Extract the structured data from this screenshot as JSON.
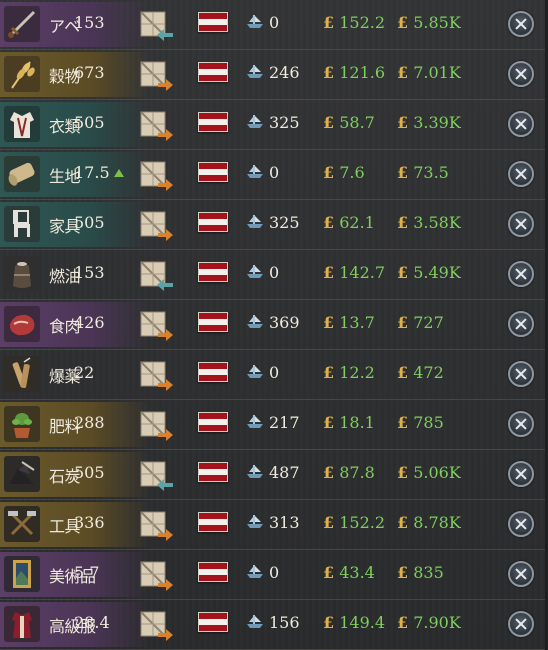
{
  "rows": [
    {
      "icon": "sword-icon",
      "name": "アベ",
      "amount": "153",
      "trend": false,
      "crate_arrow": "in",
      "ships": "0",
      "price": "152.2",
      "total": "5.85K",
      "bg": "purple"
    },
    {
      "icon": "wheat-icon",
      "name": "穀物",
      "amount": "673",
      "trend": false,
      "crate_arrow": "out",
      "ships": "246",
      "price": "121.6",
      "total": "7.01K",
      "bg": "gold"
    },
    {
      "icon": "clothes-icon",
      "name": "衣類",
      "amount": "505",
      "trend": false,
      "crate_arrow": "out",
      "ships": "325",
      "price": "58.7",
      "total": "3.39K",
      "bg": "teal"
    },
    {
      "icon": "fabric-roll-icon",
      "name": "生地",
      "amount": "17.5",
      "trend": true,
      "crate_arrow": "out",
      "ships": "0",
      "price": "7.6",
      "total": "73.5",
      "bg": "teal"
    },
    {
      "icon": "chair-icon",
      "name": "家具",
      "amount": "505",
      "trend": false,
      "crate_arrow": "out",
      "ships": "325",
      "price": "62.1",
      "total": "3.58K",
      "bg": "teal"
    },
    {
      "icon": "oil-barrel-icon",
      "name": "燃油",
      "amount": "153",
      "trend": false,
      "crate_arrow": "in",
      "ships": "0",
      "price": "142.7",
      "total": "5.49K",
      "bg": "none"
    },
    {
      "icon": "meat-icon",
      "name": "食肉",
      "amount": "426",
      "trend": false,
      "crate_arrow": "out",
      "ships": "369",
      "price": "13.7",
      "total": "727",
      "bg": "purple"
    },
    {
      "icon": "explosives-icon",
      "name": "爆薬",
      "amount": "22",
      "trend": false,
      "crate_arrow": "out",
      "ships": "0",
      "price": "12.2",
      "total": "472",
      "bg": "none"
    },
    {
      "icon": "fertilizer-plant-icon",
      "name": "肥料",
      "amount": "288",
      "trend": false,
      "crate_arrow": "out",
      "ships": "217",
      "price": "18.1",
      "total": "785",
      "bg": "gold"
    },
    {
      "icon": "coal-icon",
      "name": "石炭",
      "amount": "505",
      "trend": false,
      "crate_arrow": "in",
      "ships": "487",
      "price": "87.8",
      "total": "5.06K",
      "bg": "gold"
    },
    {
      "icon": "tools-icon",
      "name": "工具",
      "amount": "336",
      "trend": false,
      "crate_arrow": "out",
      "ships": "313",
      "price": "152.2",
      "total": "8.78K",
      "bg": "gold"
    },
    {
      "icon": "painting-icon",
      "name": "美術品",
      "amount": "5.7",
      "trend": false,
      "crate_arrow": "out",
      "ships": "0",
      "price": "43.4",
      "total": "835",
      "bg": "purple"
    },
    {
      "icon": "luxury-clothes-icon",
      "name": "高級服",
      "amount": "28.4",
      "trend": false,
      "crate_arrow": "out",
      "ships": "156",
      "price": "149.4",
      "total": "7.90K",
      "bg": "purple"
    }
  ],
  "currency_symbol": "£",
  "colors": {
    "price_green": "#7fcf5c",
    "pound_gold": "#e0b04a",
    "flag_red": "#a4121b",
    "flag_white": "#f4f1ec",
    "arrow_in": "#5aa3a8",
    "arrow_out": "#d9822b"
  }
}
